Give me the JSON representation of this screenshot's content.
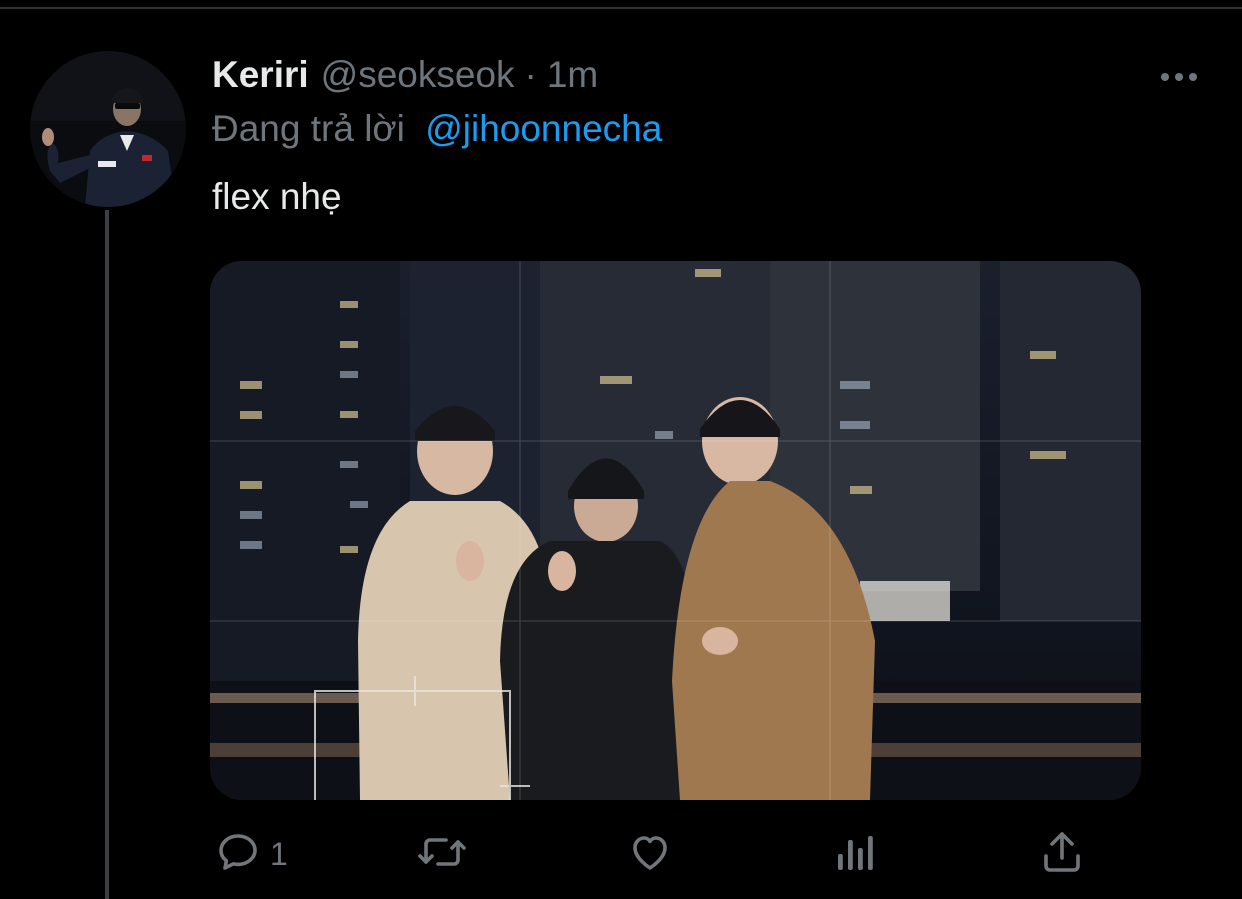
{
  "colors": {
    "background": "#000000",
    "primary_text": "#e7e9ea",
    "secondary_text": "#6e767d",
    "mention": "#1d9bf0",
    "icon": "#71767b",
    "thread_line": "#3a3d41"
  },
  "tweet": {
    "display_name": "Keriri",
    "handle": "@seokseok",
    "separator": "·",
    "time": "1m",
    "reply_prefix": "Đang trả lời",
    "reply_to": "@jihoonnecha",
    "text": "flex nhẹ",
    "media": {
      "type": "photo",
      "description_icon": "photo"
    },
    "more_icon": "more-horizontal-icon"
  },
  "actions": {
    "reply": {
      "icon": "reply-icon",
      "count": "1"
    },
    "retweet": {
      "icon": "retweet-icon"
    },
    "like": {
      "icon": "heart-icon"
    },
    "analytics": {
      "icon": "analytics-icon"
    },
    "share": {
      "icon": "share-icon"
    }
  }
}
